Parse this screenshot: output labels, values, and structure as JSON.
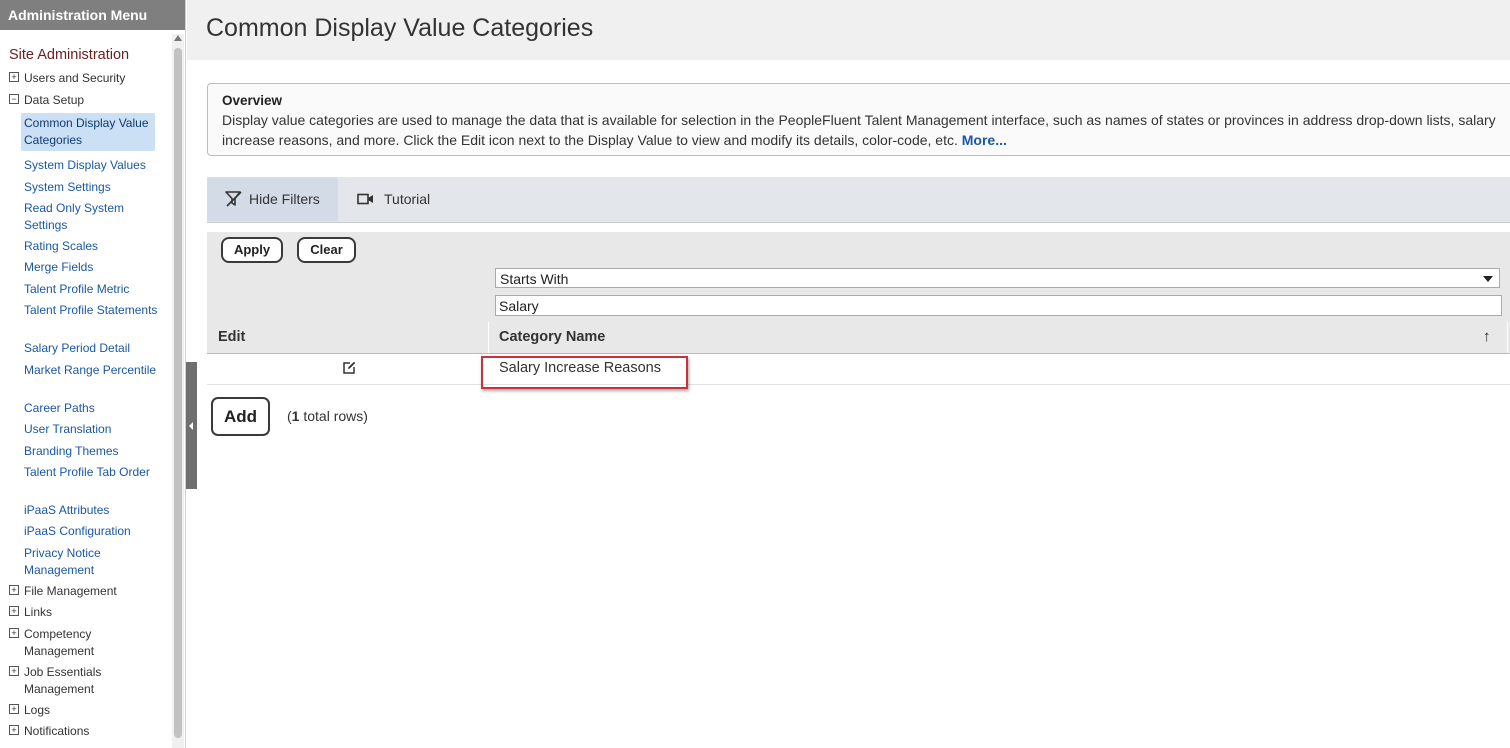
{
  "sidebar": {
    "header": "Administration Menu",
    "section_title": "Site Administration",
    "nodes": [
      {
        "label": "Users and Security",
        "expander": "+"
      },
      {
        "label": "Data Setup",
        "expander": "−"
      },
      {
        "label": "File Management",
        "expander": "+"
      },
      {
        "label": "Links",
        "expander": "+"
      },
      {
        "label": "Competency Management",
        "expander": "+"
      },
      {
        "label": "Job Essentials Management",
        "expander": "+"
      },
      {
        "label": "Logs",
        "expander": "+"
      },
      {
        "label": "Notifications",
        "expander": "+"
      }
    ],
    "data_setup_items": [
      "Common Display Value Categories",
      "System Display Values",
      "System Settings",
      "Read Only System Settings",
      "Rating Scales",
      "Merge Fields",
      "Talent Profile Metric",
      "Talent Profile Statements",
      "Salary Period Detail",
      "Market Range Percentile",
      "Career Paths",
      "User Translation",
      "Branding Themes",
      "Talent Profile Tab Order",
      "iPaaS Attributes",
      "iPaaS Configuration",
      "Privacy Notice Management"
    ]
  },
  "page": {
    "title": "Common Display Value Categories"
  },
  "overview": {
    "title": "Overview",
    "text": "Display value categories are used to manage the data that is available for selection in the PeopleFluent Talent Management interface, such as names of states or provinces in address drop-down lists, salary increase reasons, and more. Click the Edit icon next to the Display Value to view and modify its details, color-code, etc.",
    "more_link": "More..."
  },
  "toolbar": {
    "hide_filters": "Hide Filters",
    "tutorial": "Tutorial"
  },
  "filters": {
    "apply": "Apply",
    "clear": "Clear",
    "match_mode": "Starts With",
    "search_value": "Salary"
  },
  "grid": {
    "columns": {
      "edit": "Edit",
      "category": "Category Name"
    },
    "sort_indicator": "↑",
    "rows": [
      {
        "category": "Salary Increase Reasons"
      }
    ]
  },
  "footer": {
    "add": "Add",
    "count_number": "1",
    "count_suffix": " total rows)",
    "count_prefix": "("
  },
  "colors": {
    "link": "#1a57a6",
    "highlight": "#c8323c",
    "selected_bg": "#cce0f5",
    "header_gray": "#7f7f7f"
  }
}
